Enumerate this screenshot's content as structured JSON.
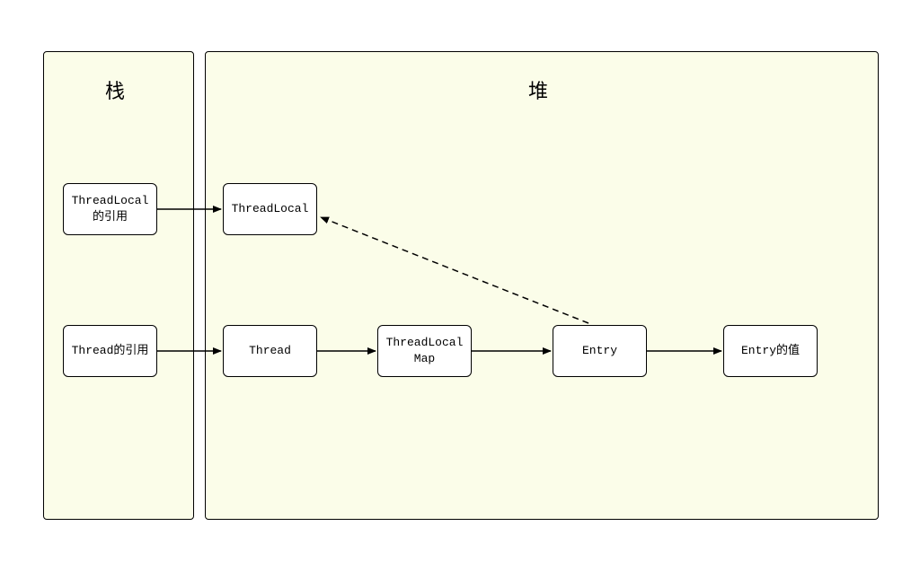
{
  "containers": {
    "stack": {
      "title": "栈"
    },
    "heap": {
      "title": "堆"
    }
  },
  "nodes": {
    "threadlocal_ref": "ThreadLocal\n的引用",
    "thread_ref": "Thread的引用",
    "threadlocal": "ThreadLocal",
    "thread": "Thread",
    "threadlocalmap": "ThreadLocal\nMap",
    "entry": "Entry",
    "entry_value": "Entry的值"
  },
  "arrows": [
    {
      "from": "threadlocal_ref",
      "to": "threadlocal",
      "style": "solid"
    },
    {
      "from": "thread_ref",
      "to": "thread",
      "style": "solid"
    },
    {
      "from": "thread",
      "to": "threadlocalmap",
      "style": "solid"
    },
    {
      "from": "threadlocalmap",
      "to": "entry",
      "style": "solid"
    },
    {
      "from": "entry",
      "to": "entry_value",
      "style": "solid"
    },
    {
      "from": "entry",
      "to": "threadlocal",
      "style": "dashed"
    }
  ]
}
